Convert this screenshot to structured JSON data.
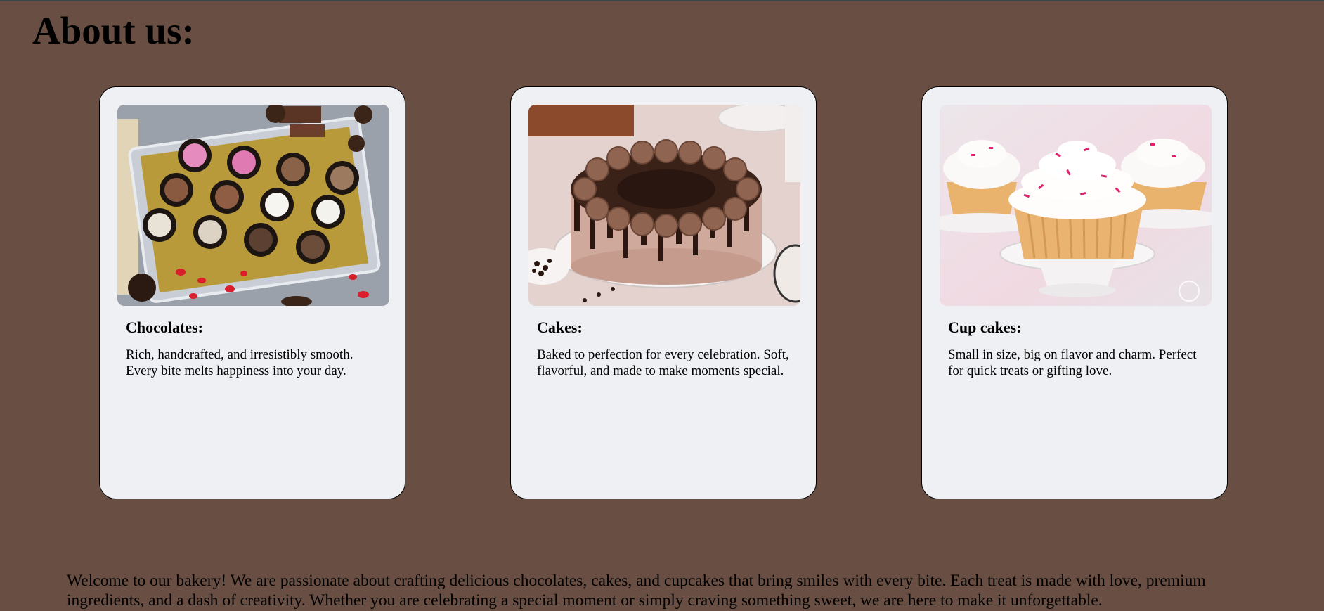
{
  "page": {
    "title": "About us:"
  },
  "cards": [
    {
      "title": "Chocolates:",
      "text": "Rich, handcrafted, and irresistibly smooth. Every bite melts happiness into your day.",
      "image": "chocolate-box-photo"
    },
    {
      "title": "Cakes:",
      "text": "Baked to perfection for every celebration. Soft, flavorful, and made to make moments special.",
      "image": "chocolate-cake-photo"
    },
    {
      "title": "Cup cakes:",
      "text": "Small in size, big on flavor and charm. Perfect for quick treats or gifting love.",
      "image": "cupcakes-photo"
    }
  ],
  "welcome": {
    "text": "Welcome to our bakery! We are passionate about crafting delicious chocolates, cakes, and cupcakes that bring smiles with every bite. Each treat is made with love, premium ingredients, and a dash of creativity. Whether you are celebrating a special moment or simply craving something sweet, we are here to make it unforgettable."
  },
  "colors": {
    "background": "#694f43",
    "card_background": "#eff0f4",
    "text": "#000000"
  }
}
